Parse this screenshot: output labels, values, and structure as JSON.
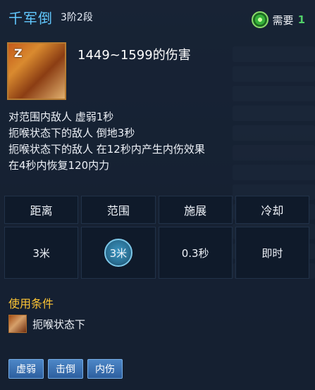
{
  "skill": {
    "title": "千军倒",
    "subtitle": "3阶2段",
    "requirement": {
      "label": "需要",
      "number": "1",
      "icon": "green-orb-icon"
    },
    "icon": {
      "letter": "Z",
      "name": "skill-icon"
    },
    "damage": "1449~1599的伤害",
    "description": [
      "对范围内敌人 虚弱1秒",
      "扼喉状态下的敌人 倒地3秒",
      "扼喉状态下的敌人 在12秒内产生内伤效果",
      "在4秒内恢复120内力"
    ],
    "stats_headers": [
      "距离",
      "范围",
      "施展",
      "冷却"
    ],
    "stats_values": [
      "3米",
      "3米",
      "0.3秒",
      "即时"
    ],
    "condition": {
      "title": "使用条件",
      "text": "扼喉状态下",
      "icon": "condition-icon"
    },
    "tags": [
      "虚弱",
      "击倒",
      "内伤"
    ]
  },
  "colors": {
    "title": "#62c9ff",
    "condition_title": "#ffc634",
    "tag_bg": "#3b72b6",
    "requirement_number": "#52d16a"
  }
}
